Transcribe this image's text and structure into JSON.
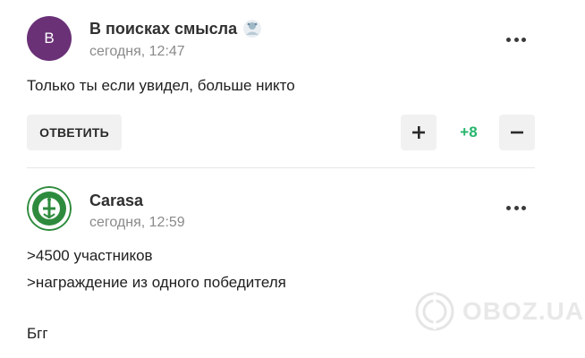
{
  "comments": [
    {
      "author": "В поисках смысла",
      "avatar_letter": "В",
      "avatar_color": "#6a3177",
      "timestamp": "сегодня, 12:47",
      "lines": [
        "Только ты если увидел, больше никто"
      ],
      "reply_label": "ОТВЕТИТЬ",
      "vote_count": "+8",
      "vote_color": "#24b56b"
    },
    {
      "author": "Carasa",
      "timestamp": "сегодня, 12:59",
      "lines": [
        ">4500 участников",
        ">награждение из одного победителя",
        "Бгг"
      ]
    }
  ],
  "watermark": "OBOZ.UA"
}
